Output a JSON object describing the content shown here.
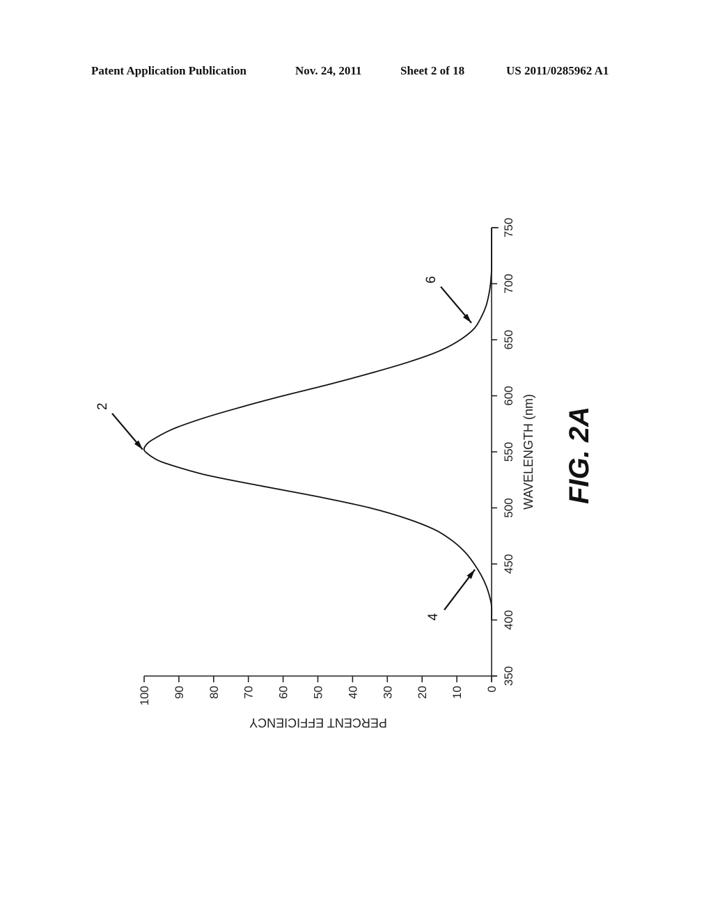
{
  "header": {
    "publication": "Patent Application Publication",
    "date": "Nov. 24, 2011",
    "sheet": "Sheet 2 of 18",
    "number": "US 2011/0285962 A1"
  },
  "figure_label": "FIG. 2A",
  "chart_data": {
    "type": "line",
    "title": "",
    "orientation": "rotated 90° counter-clockwise (wavelength axis vertical, efficiency axis horizontal)",
    "xlabel": "WAVELENGTH (nm)",
    "ylabel": "PERCENT EFFICIENCY",
    "xlim": [
      350,
      750
    ],
    "ylim": [
      0,
      100
    ],
    "x_ticks": [
      350,
      400,
      450,
      500,
      550,
      600,
      650,
      700,
      750
    ],
    "y_ticks": [
      0,
      10,
      20,
      30,
      40,
      50,
      60,
      70,
      80,
      90,
      100
    ],
    "grid": false,
    "legend": "none",
    "series": [
      {
        "name": "efficiency curve",
        "x": [
          400,
          412,
          420,
          430,
          440,
          450,
          460,
          470,
          480,
          490,
          500,
          510,
          520,
          530,
          540,
          545,
          550,
          552,
          555,
          560,
          570,
          580,
          590,
          600,
          610,
          620,
          630,
          640,
          650,
          660,
          670,
          680,
          690,
          700,
          710,
          715,
          720,
          750
        ],
        "values": [
          0,
          0,
          0.5,
          1.5,
          3,
          5,
          7.5,
          11,
          16,
          24,
          35,
          50,
          67,
          83,
          94,
          97.5,
          99.6,
          100,
          99.7,
          98,
          92,
          83,
          72,
          60,
          47,
          35,
          24,
          15,
          9,
          5,
          3,
          1.6,
          0.8,
          0.3,
          0.05,
          0,
          0,
          0
        ]
      }
    ],
    "annotations": [
      {
        "label": "2",
        "points_to_x": 552,
        "points_to_y": 100,
        "description": "peak"
      },
      {
        "label": "4",
        "points_to_x": 445,
        "points_to_y": 4,
        "description": "short-wavelength tail"
      },
      {
        "label": "6",
        "points_to_x": 665,
        "points_to_y": 5,
        "description": "long-wavelength tail"
      }
    ]
  }
}
